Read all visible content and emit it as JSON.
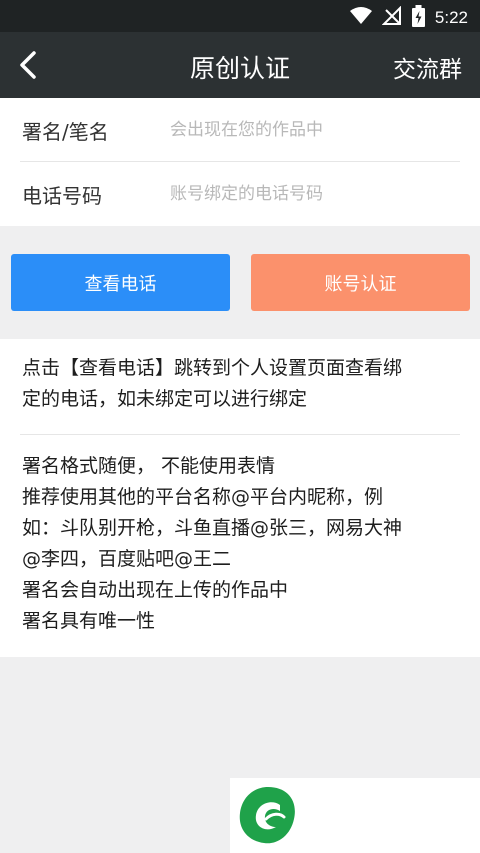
{
  "status_bar": {
    "time": "5:22"
  },
  "header": {
    "title": "原创认证",
    "group_label": "交流群"
  },
  "form": {
    "signature": {
      "label": "署名/笔名",
      "placeholder": "会出现在您的作品中"
    },
    "phone": {
      "label": "电话号码",
      "placeholder": "账号绑定的电话号码"
    }
  },
  "buttons": {
    "view_phone": "查看电话",
    "verify_account": "账号认证"
  },
  "info": {
    "para1_lines": [
      "点击【查看电话】跳转到个人设置页面查看绑",
      "定的电话，如未绑定可以进行绑定"
    ],
    "para2_lines": [
      "署名格式随便， 不能使用表情",
      "推荐使用其他的平台名称@平台内昵称，例",
      "如：斗队别开枪，斗鱼直播@张三，网易大神",
      "@李四，百度贴吧@王二",
      "署名会自动出现在上传的作品中",
      "署名具有唯一性"
    ]
  },
  "colors": {
    "header_bg": "#2c3133",
    "blue_button": "#2b8ef8",
    "orange_button": "#fb916c",
    "logo_green": "#1fa24a"
  }
}
